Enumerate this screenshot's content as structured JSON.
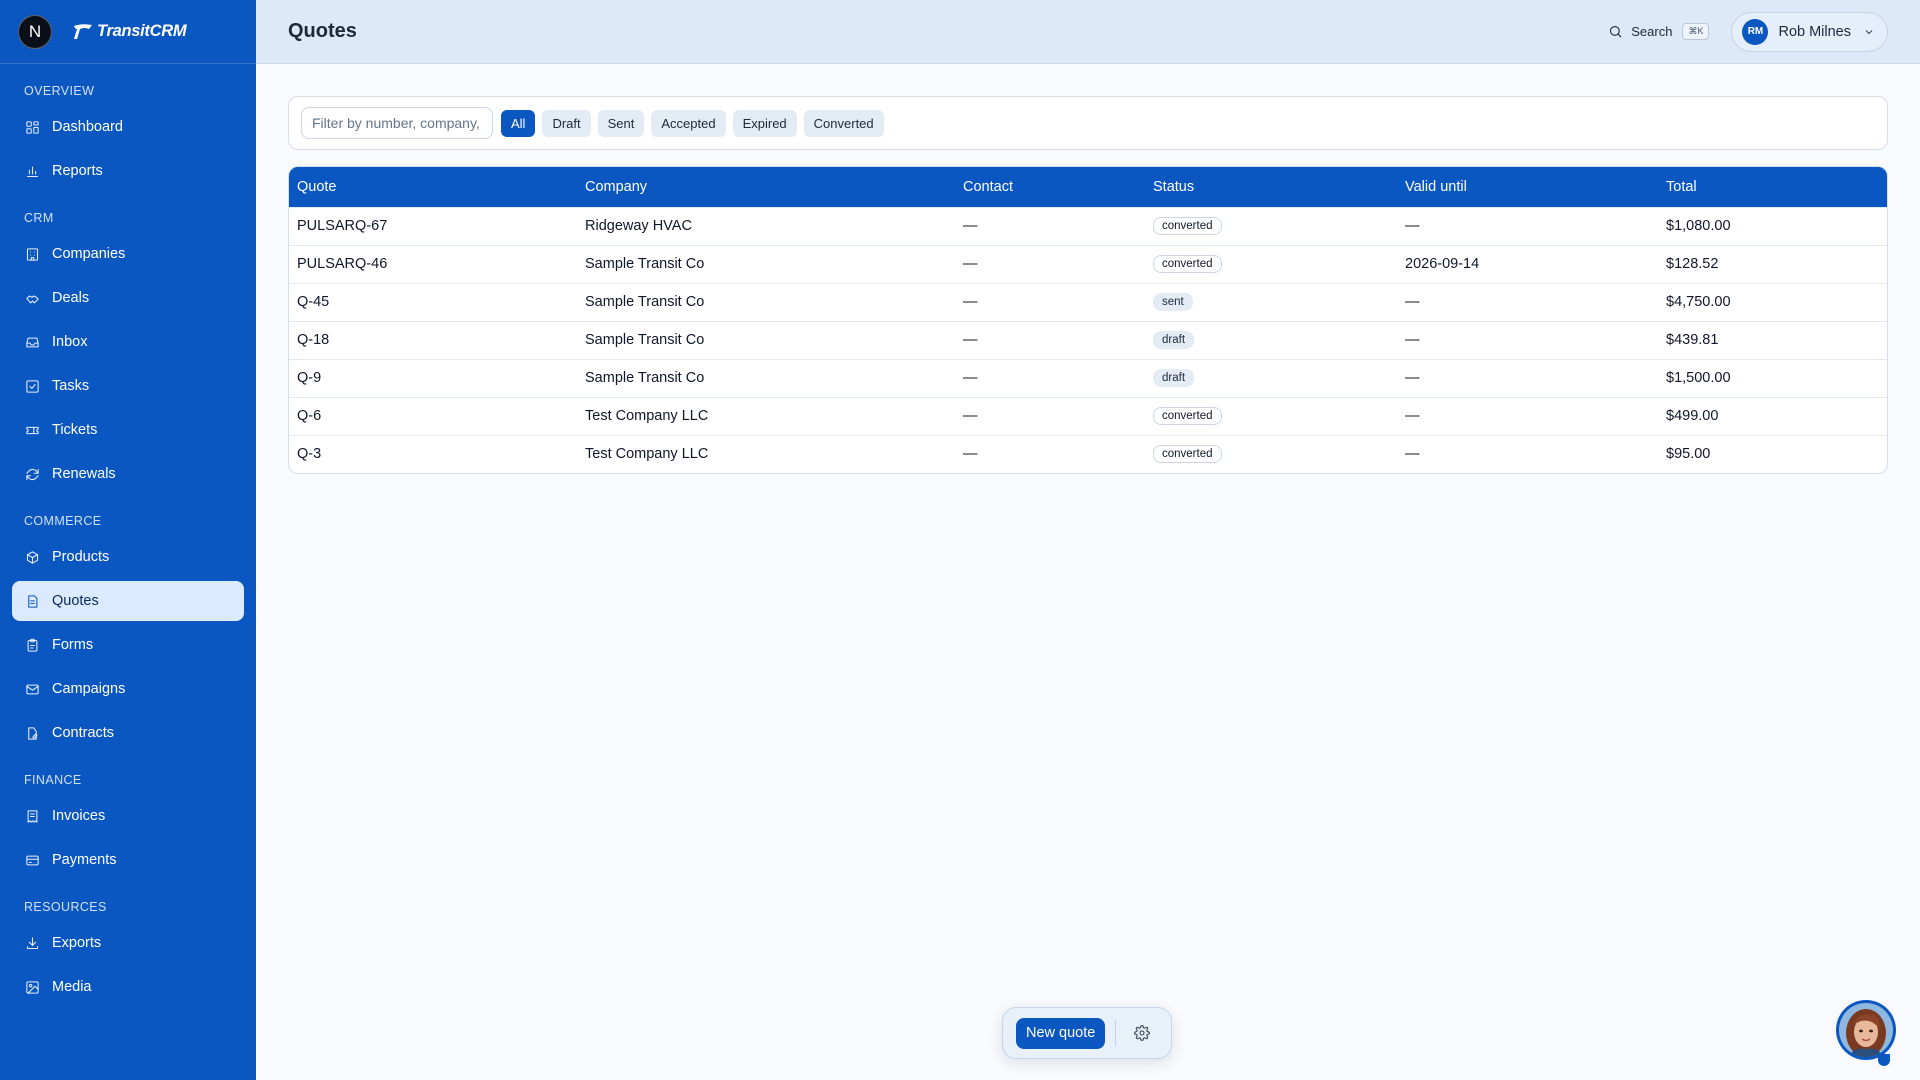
{
  "brand": {
    "avatar_letter": "N",
    "name": "TransitCRM",
    "color": "#0a57c2"
  },
  "sidebar": {
    "sections": [
      {
        "title": "OVERVIEW",
        "items": [
          {
            "label": "Dashboard",
            "icon": "dashboard-icon"
          },
          {
            "label": "Reports",
            "icon": "bar-chart-icon"
          }
        ]
      },
      {
        "title": "CRM",
        "items": [
          {
            "label": "Companies",
            "icon": "building-icon"
          },
          {
            "label": "Deals",
            "icon": "handshake-icon"
          },
          {
            "label": "Inbox",
            "icon": "inbox-icon"
          },
          {
            "label": "Tasks",
            "icon": "checkbox-icon"
          },
          {
            "label": "Tickets",
            "icon": "ticket-icon"
          },
          {
            "label": "Renewals",
            "icon": "refresh-icon"
          }
        ]
      },
      {
        "title": "COMMERCE",
        "items": [
          {
            "label": "Products",
            "icon": "package-icon"
          },
          {
            "label": "Quotes",
            "icon": "document-icon",
            "active": true
          },
          {
            "label": "Forms",
            "icon": "clipboard-icon"
          },
          {
            "label": "Campaigns",
            "icon": "mail-icon"
          },
          {
            "label": "Contracts",
            "icon": "file-edit-icon"
          }
        ]
      },
      {
        "title": "FINANCE",
        "items": [
          {
            "label": "Invoices",
            "icon": "receipt-icon"
          },
          {
            "label": "Payments",
            "icon": "credit-card-icon"
          }
        ]
      },
      {
        "title": "RESOURCES",
        "items": [
          {
            "label": "Exports",
            "icon": "download-icon"
          },
          {
            "label": "Media",
            "icon": "image-icon"
          }
        ]
      }
    ]
  },
  "header": {
    "title": "Quotes",
    "search_label": "Search",
    "search_shortcut": "⌘K",
    "user": {
      "initials": "RM",
      "name": "Rob Milnes"
    }
  },
  "filters": {
    "placeholder": "Filter by number, company, contact",
    "chips": [
      {
        "label": "All",
        "active": true
      },
      {
        "label": "Draft"
      },
      {
        "label": "Sent"
      },
      {
        "label": "Accepted"
      },
      {
        "label": "Expired"
      },
      {
        "label": "Converted"
      }
    ]
  },
  "table": {
    "columns": [
      "Quote",
      "Company",
      "Contact",
      "Status",
      "Valid until",
      "Total"
    ],
    "rows": [
      {
        "quote": "PULSARQ-67",
        "company": "Ridgeway HVAC",
        "contact": "—",
        "status": "converted",
        "valid_until": "—",
        "total": "$1,080.00"
      },
      {
        "quote": "PULSARQ-46",
        "company": "Sample Transit Co",
        "contact": "—",
        "status": "converted",
        "valid_until": "2026-09-14",
        "total": "$128.52"
      },
      {
        "quote": "Q-45",
        "company": "Sample Transit Co",
        "contact": "—",
        "status": "sent",
        "valid_until": "—",
        "total": "$4,750.00"
      },
      {
        "quote": "Q-18",
        "company": "Sample Transit Co",
        "contact": "—",
        "status": "draft",
        "valid_until": "—",
        "total": "$439.81"
      },
      {
        "quote": "Q-9",
        "company": "Sample Transit Co",
        "contact": "—",
        "status": "draft",
        "valid_until": "—",
        "total": "$1,500.00"
      },
      {
        "quote": "Q-6",
        "company": "Test Company LLC",
        "contact": "—",
        "status": "converted",
        "valid_until": "—",
        "total": "$499.00"
      },
      {
        "quote": "Q-3",
        "company": "Test Company LLC",
        "contact": "—",
        "status": "converted",
        "valid_until": "—",
        "total": "$95.00"
      }
    ]
  },
  "actions": {
    "new_quote_label": "New quote",
    "settings_icon": "gear-icon"
  },
  "assistant": {
    "icon": "assistant-avatar-icon"
  }
}
